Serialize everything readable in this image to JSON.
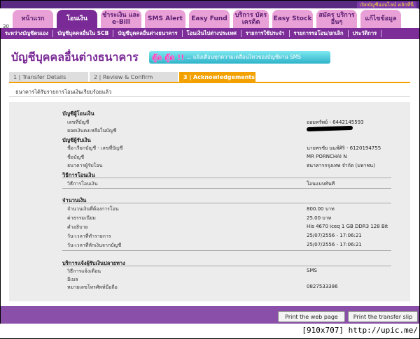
{
  "topbar": {
    "welcome": "เปิดบัญชีออนไลน์ คลิกที่นี่"
  },
  "tab_number": "30",
  "tabs": [
    {
      "label": "หน้าแรก"
    },
    {
      "label": "โอนเงิน"
    },
    {
      "label": "ชำระเงิน และ e-Bill"
    },
    {
      "label": "SMS Alert"
    },
    {
      "label": "Easy Fund"
    },
    {
      "label": "บริการ บัตรเครดิต"
    },
    {
      "label": "Easy Stock"
    },
    {
      "label": "สมัคร บริการอื่นๆ"
    },
    {
      "label": "แก้ไขข้อมูล"
    }
  ],
  "subnav": [
    "ระหว่างบัญชีตนเอง",
    "บัญชีบุคคลอื่นใน SCB",
    "บัญชีบุคคลอื่นต่างธนาคาร",
    "โอนเงินไปต่างประเทศ",
    "รายการใช้ประจำ",
    "รายการรอโอน/ยกเลิก",
    "ประวัติการ"
  ],
  "page": {
    "title": "บัญชีบุคคลอื่นต่างธนาคาร",
    "banner_emph": "ตู๊ด ตู๊ด !!",
    "banner_text": "... แจ้งเตือนทุกความเคลื่อนไหวของบัญชีผ่าน SMS",
    "success": "ธนาคารได้รับรายการโอนเงินเรียบร้อยแล้ว"
  },
  "steps": {
    "s1": "1 | Transfer Details",
    "s2": "2 | Review & Confirm",
    "s3": "3 | Acknowledgements"
  },
  "details": {
    "from_heading": "บัญชีผู้โอนเงิน",
    "from_account_label": "เลขที่บัญชี",
    "from_account_value": "ออมทรัพย์ - 6442145593",
    "balance_label": "ยอดเงินคงเหลือในบัญชี",
    "to_heading": "บัญชีผู้รับเงิน",
    "to_name_no_label": "ชื่อ-เรียกบัญชี - เลขที่บัญชี",
    "to_name_no_value": "นายพรชัย นนท์ศิริ - 6120194755",
    "to_acc_name_label": "ชื่อบัญชี",
    "to_acc_name_value": "MR PORNCHAI N",
    "to_bank_label": "ธนาคารผู้รับโอน",
    "to_bank_value": "ธนาคารกรุงเทพ จำกัด (มหาชน)",
    "method_heading": "วิธีการโอนเงิน",
    "method_label": "วิธีการโอนเงิน",
    "method_value": "โอนแบบทันที",
    "amount_heading": "จำนวนเงิน",
    "amount_label": "จำนวนเงินที่ต้องการโอน",
    "amount_value": "800.00 บาท",
    "fee_label": "ค่าธรรมเนียม",
    "fee_value": "25.00 บาท",
    "desc_label": "คำอธิบาย",
    "desc_value": "His 4670 iceq 1 GB DDR3 128 Bit",
    "txn_date_label": "วัน-เวลาที่ทำรายการ",
    "txn_date_value": "25/07/2556 - 17:06:21",
    "debit_date_label": "วัน-เวลาที่หักเงินจากบัญชี",
    "debit_date_value": "25/07/2556 - 17:06:21",
    "notify_heading": "บริการแจ้งผู้รับเงินปลายทาง",
    "notify_method_label": "วิธีการแจ้งเตือน",
    "notify_method_value": "SMS",
    "email_label": "อีเมล",
    "phone_label": "หมายเลขโทรศัพท์มือถือ",
    "phone_value": "0827533386"
  },
  "buttons": {
    "print_page": "Print the web page",
    "print_slip": "Print the transfer slip"
  },
  "watermark": "[910x707] http://upic.me/"
}
